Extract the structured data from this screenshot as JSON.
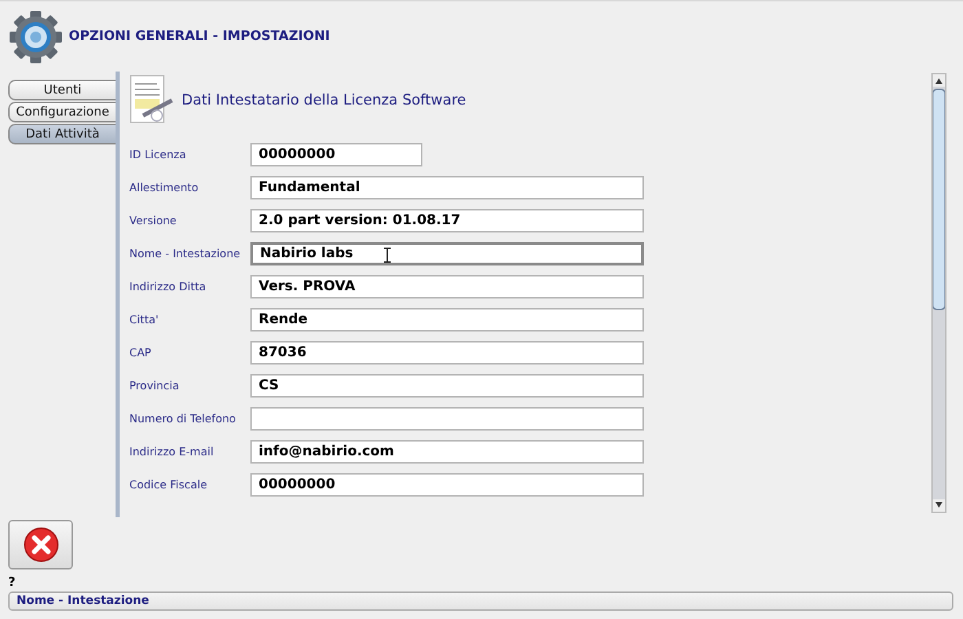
{
  "window": {
    "title": "OPZIONI GENERALI - IMPOSTAZIONI"
  },
  "tabs": [
    {
      "label": "Utenti",
      "selected": false
    },
    {
      "label": "Configurazione",
      "selected": false
    },
    {
      "label": "Dati Attività",
      "selected": true
    }
  ],
  "section": {
    "title": "Dati Intestatario della Licenza Software"
  },
  "fields": [
    {
      "label": "ID Licenza",
      "value": "00000000",
      "kind": "short",
      "focused": false
    },
    {
      "label": "Allestimento",
      "value": "Fundamental",
      "kind": "long",
      "focused": false
    },
    {
      "label": "Versione",
      "value": "2.0 part version: 01.08.17",
      "kind": "long",
      "focused": false
    },
    {
      "label": "Nome - Intestazione",
      "value": "Nabirio labs",
      "kind": "long",
      "focused": true
    },
    {
      "label": "Indirizzo Ditta",
      "value": "Vers. PROVA",
      "kind": "long",
      "focused": false
    },
    {
      "label": "Citta'",
      "value": "Rende",
      "kind": "long",
      "focused": false
    },
    {
      "label": "CAP",
      "value": "87036",
      "kind": "long",
      "focused": false
    },
    {
      "label": "Provincia",
      "value": "CS",
      "kind": "long",
      "focused": false
    },
    {
      "label": "Numero di Telefono",
      "kind": "long",
      "focused": false
    },
    {
      "label": "Indirizzo E-mail",
      "value": "info@nabirio.com",
      "kind": "long",
      "focused": false
    },
    {
      "label": "Codice Fiscale",
      "value": "00000000",
      "kind": "long",
      "focused": false
    }
  ],
  "help": "?",
  "status_bar": "Nome - Intestazione"
}
